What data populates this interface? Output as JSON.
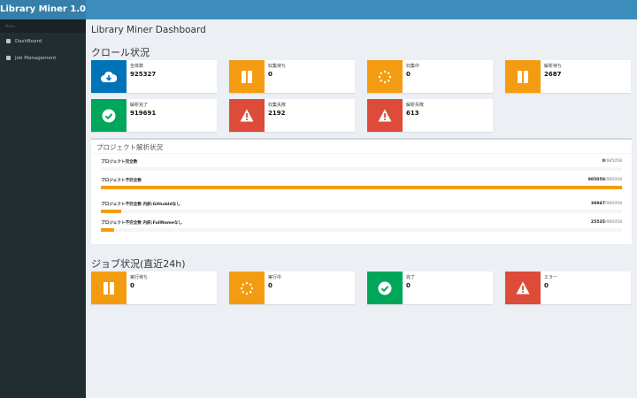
{
  "app": {
    "title": "Library Miner 1.0"
  },
  "sidebar": {
    "header": "Menu",
    "items": [
      {
        "label": "DashBoard"
      },
      {
        "label": "Job Management"
      }
    ]
  },
  "page_title": "Library Miner Dashboard",
  "crawl": {
    "title": "クロール状況",
    "boxes": [
      {
        "label": "全体数",
        "value": "925327",
        "icon": "cloud-download-icon",
        "color": "#0073b7"
      },
      {
        "label": "収集待ち",
        "value": "0",
        "icon": "pause-icon",
        "color": "#f39c12"
      },
      {
        "label": "収集中",
        "value": "0",
        "icon": "spinner-icon",
        "color": "#f39c12"
      },
      {
        "label": "解析待ち",
        "value": "2687",
        "icon": "pause-icon",
        "color": "#f39c12"
      },
      {
        "label": "解析完了",
        "value": "919691",
        "icon": "check-circle-icon",
        "color": "#00a65a"
      },
      {
        "label": "収集失敗",
        "value": "2192",
        "icon": "warning-icon",
        "color": "#dd4b39"
      },
      {
        "label": "解析失敗",
        "value": "613",
        "icon": "warning-icon",
        "color": "#dd4b39"
      }
    ]
  },
  "project": {
    "title": "プロジェクト解析状況",
    "bars": [
      {
        "label": "プロジェクト完全数",
        "value": "0",
        "total": "/985058",
        "fraction": 0
      },
      {
        "label": "プロジェクト不完全数",
        "value": "985058",
        "total": "/985058",
        "fraction": 1
      },
      {
        "label": "プロジェクト不完全数 内訳:Githubldなし",
        "value": "38947",
        "total": "/985058",
        "fraction": 0.0395
      },
      {
        "label": "プロジェクト不完全数 内訳:FullNameなし",
        "value": "25535",
        "total": "/985058",
        "fraction": 0.0259
      }
    ]
  },
  "jobs": {
    "title": "ジョブ状況(直近24h)",
    "boxes": [
      {
        "label": "実行待ち",
        "value": "0",
        "icon": "pause-icon",
        "color": "#f39c12"
      },
      {
        "label": "実行中",
        "value": "0",
        "icon": "spinner-icon",
        "color": "#f39c12"
      },
      {
        "label": "完了",
        "value": "0",
        "icon": "check-circle-icon",
        "color": "#00a65a"
      },
      {
        "label": "エラー",
        "value": "0",
        "icon": "warning-icon",
        "color": "#dd4b39"
      }
    ]
  }
}
